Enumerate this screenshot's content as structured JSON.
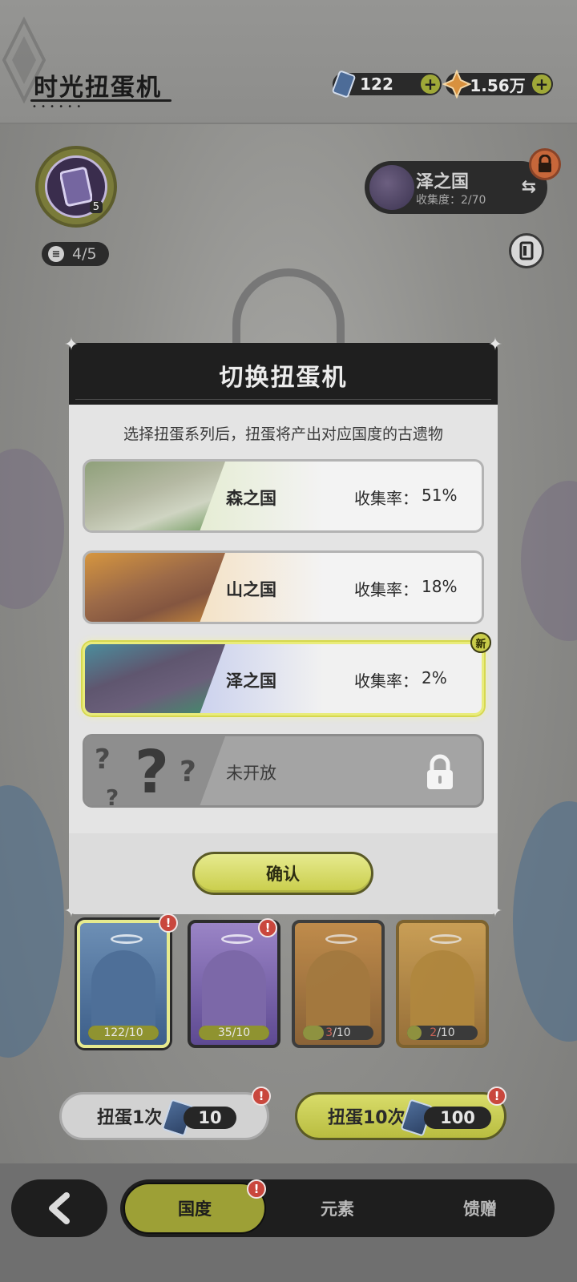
{
  "header": {
    "title": "时光扭蛋机",
    "currency_tickets": "122",
    "currency_stars": "1.56万"
  },
  "medal": {
    "count": "5"
  },
  "progress": {
    "text": "4/5"
  },
  "country_chip": {
    "name": "泽之国",
    "collection": "收集度：2/70"
  },
  "modal": {
    "title": "切换扭蛋机",
    "description": "选择扭蛋系列后，扭蛋将产出对应国度的古遗物",
    "rate_label": "收集率：",
    "options": [
      {
        "name": "森之国",
        "rate": "51%"
      },
      {
        "name": "山之国",
        "rate": "18%"
      },
      {
        "name": "泽之国",
        "rate": "2%",
        "badge": "新",
        "selected": true
      },
      {
        "name": "未开放",
        "locked": true
      }
    ],
    "confirm_label": "确认"
  },
  "cards": [
    {
      "count": "122/10",
      "progress": 1.0
    },
    {
      "count": "35/10",
      "progress": 1.0
    },
    {
      "count_current": "3",
      "count_total": "/10",
      "progress": 0.3
    },
    {
      "count_current": "2",
      "count_total": "/10",
      "progress": 0.2
    }
  ],
  "gacha": {
    "single_label": "扭蛋1次",
    "single_cost": "10",
    "ten_label": "扭蛋10次",
    "ten_cost": "100"
  },
  "nav": {
    "tabs": [
      "国度",
      "元素",
      "馈赠"
    ],
    "active_tab": "国度"
  },
  "colors": {
    "accent": "#c9cd4a",
    "alert": "#c9473d",
    "dark": "#1e1e1e"
  }
}
